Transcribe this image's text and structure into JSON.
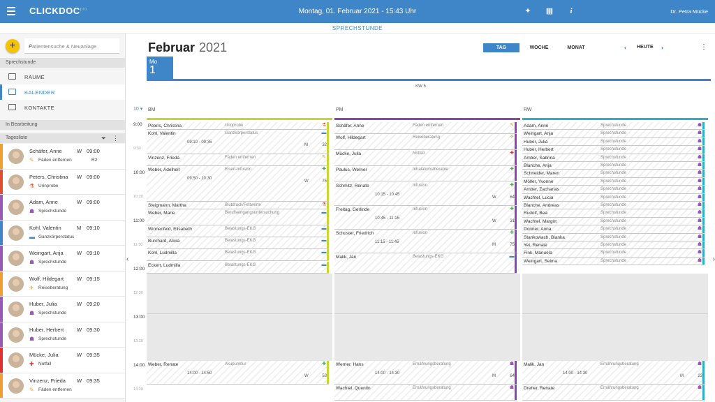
{
  "topbar": {
    "logo": "CLICKDOC",
    "logo_sup": "pro",
    "datetime": "Montag, 01. Februar 2021 - 15:43 Uhr",
    "user": "Dr. Petra Mücke",
    "icons": [
      "menu-icon",
      "magic-wand-icon",
      "calendar-icon",
      "info-icon"
    ]
  },
  "subbar": {
    "title": "SPRECHSTUNDE"
  },
  "sidebar": {
    "search_placeholder": "Patientensuche & Neuanlage",
    "section_sprechstunde": "Sprechstunde",
    "nav": [
      {
        "label": "RÄUME",
        "icon": "rooms-icon"
      },
      {
        "label": "KALENDER",
        "icon": "calendar-icon",
        "active": true
      },
      {
        "label": "KONTAKTE",
        "icon": "contacts-icon"
      }
    ],
    "section_bearbeitung": "In Bearbeitung",
    "tagesliste": "Tagesliste",
    "patients": [
      {
        "name": "Schäfer, Anne",
        "reason": "Fäden entfernen",
        "w": "W",
        "time": "09:00",
        "room": "R2",
        "color": "#f0a030",
        "icon": "✎"
      },
      {
        "name": "Peters, Christina",
        "reason": "Urinprobe",
        "w": "W",
        "time": "09:00",
        "room": "",
        "color": "#e05030",
        "icon": "⚗"
      },
      {
        "name": "Adam, Anne",
        "reason": "Sprechstunde",
        "w": "W",
        "time": "09:00",
        "room": "",
        "color": "#9b59b6",
        "icon": "☗"
      },
      {
        "name": "Kohl, Valentin",
        "reason": "Ganzkörperstatus",
        "w": "M",
        "time": "09:10",
        "room": "",
        "color": "#3f86c8",
        "icon": "▬"
      },
      {
        "name": "Weingart, Anja",
        "reason": "Sprechstunde",
        "w": "W",
        "time": "09:10",
        "room": "",
        "color": "#9b59b6",
        "icon": "☗"
      },
      {
        "name": "Wolf, Hildegart",
        "reason": "Reiseberatung",
        "w": "W",
        "time": "09:15",
        "room": "",
        "color": "#f0a030",
        "icon": "✈"
      },
      {
        "name": "Huber, Julia",
        "reason": "Sprechstunde",
        "w": "W",
        "time": "09:20",
        "room": "",
        "color": "#9b59b6",
        "icon": "☗"
      },
      {
        "name": "Huber, Herbert",
        "reason": "Sprechstunde",
        "w": "W",
        "time": "09:30",
        "room": "",
        "color": "#9b59b6",
        "icon": "☗"
      },
      {
        "name": "Mücke, Julia",
        "reason": "Notfall",
        "w": "W",
        "time": "09:35",
        "room": "",
        "color": "#e03030",
        "icon": "✚"
      },
      {
        "name": "Vinzenz, Frieda",
        "reason": "Fäden entfernen",
        "w": "W",
        "time": "09:35",
        "room": "",
        "color": "#f0a030",
        "icon": "✎"
      }
    ]
  },
  "calendar": {
    "month": "Februar",
    "year": "2021",
    "views": [
      "TAG",
      "WOCHE",
      "MONAT"
    ],
    "active_view": "TAG",
    "today_label": "HEUTE",
    "day_name": "Mo",
    "day_num": "1",
    "kw": "KW 5",
    "zoom": "10",
    "times": [
      "9:00",
      "9:30",
      "10:00",
      "10:30",
      "11:00",
      "11:30",
      "12:00",
      "12:30",
      "13:00",
      "13:30",
      "14:00",
      "14:30"
    ],
    "columns": [
      {
        "name": "BM",
        "color": "#c8d62e",
        "appointments": [
          {
            "name": "Peters, Christina",
            "reason": "Urinprobe",
            "slot": 0,
            "rows": 1,
            "icon": "⚗",
            "iconcolor": "#e05030"
          },
          {
            "name": "Kohl, Valentin",
            "reason": "Ganzkörperstatus",
            "time": "09:10 - 09:35",
            "gender": "M",
            "age": "32",
            "slot": 1,
            "rows": 3,
            "icon": "▬",
            "iconcolor": "#3f86c8"
          },
          {
            "name": "Vinzenz, Frieda",
            "reason": "Fäden entfernen",
            "slot": 4,
            "rows": 1.5,
            "icon": "✎",
            "iconcolor": "#f0a030"
          },
          {
            "name": "Weber, Adelheit",
            "reason": "Eisen-Infusion",
            "time": "09:50 - 10:30",
            "gender": "W",
            "age": "75",
            "slot": 5.5,
            "rows": 4.5,
            "icon": "✚",
            "iconcolor": "#4caf50"
          },
          {
            "name": "Steigmann, Martha",
            "reason": "Blutdruck/Fettwerte",
            "slot": 10,
            "rows": 1,
            "icon": "⚗",
            "iconcolor": "#e05030"
          },
          {
            "name": "Weber, Marie",
            "reason": "Berufseingangsuntersuchung",
            "slot": 11,
            "rows": 2,
            "icon": "▬",
            "iconcolor": "#3f86c8"
          },
          {
            "name": "Winnenfeld, Elisabeth",
            "reason": "Belastungs-EKG",
            "slot": 13,
            "rows": 1.5,
            "icon": "▬",
            "iconcolor": "#3f86c8"
          },
          {
            "name": "Burchard, Alicia",
            "reason": "Belastungs-EKG",
            "slot": 14.5,
            "rows": 1.5,
            "icon": "▬",
            "iconcolor": "#3f86c8"
          },
          {
            "name": "Kohl, Ludmilla",
            "reason": "Belastungs-EKG",
            "slot": 16,
            "rows": 1.5,
            "icon": "▬",
            "iconcolor": "#3f86c8"
          },
          {
            "name": "Eckert, Ludmilla",
            "reason": "Belastungs-EKG",
            "slot": 17.5,
            "rows": 1.5,
            "icon": "▬",
            "iconcolor": "#3f86c8"
          },
          {
            "name": "Weber, Renate",
            "reason": "Akupunktur",
            "time": "14:00 - 14:50",
            "gender": "W",
            "age": "53",
            "slot": 30,
            "rows": 3,
            "icon": "✚",
            "iconcolor": "#4caf50"
          }
        ]
      },
      {
        "name": "PM",
        "color": "#8e44ad",
        "appointments": [
          {
            "name": "Schäfer, Anne",
            "reason": "Fäden entfernen",
            "slot": 0,
            "rows": 1.5,
            "icon": "✎",
            "iconcolor": "#f0a030"
          },
          {
            "name": "Wolf, Hildegart",
            "reason": "Reiseberatung",
            "slot": 1.5,
            "rows": 2,
            "icon": "✈",
            "iconcolor": "#f0a030"
          },
          {
            "name": "Mücke, Julia",
            "reason": "Notfall",
            "slot": 3.5,
            "rows": 2,
            "icon": "✚",
            "iconcolor": "#e03030"
          },
          {
            "name": "Paulus, Werner",
            "reason": "Inhalationstherapie",
            "slot": 5.5,
            "rows": 2,
            "icon": "✚",
            "iconcolor": "#4caf50"
          },
          {
            "name": "Schmitz, Renate",
            "reason": "Infusion",
            "time": "10:15 - 10:45",
            "gender": "W",
            "age": "64",
            "slot": 7.5,
            "rows": 3,
            "icon": "✚",
            "iconcolor": "#4caf50"
          },
          {
            "name": "Freitag, Gerlinde",
            "reason": "Infusion",
            "time": "10:45 - 11:15",
            "gender": "W",
            "age": "31",
            "slot": 10.5,
            "rows": 3,
            "icon": "✚",
            "iconcolor": "#4caf50"
          },
          {
            "name": "Schuster, Friedrich",
            "reason": "Infusion",
            "time": "11:15 - 11:45",
            "gender": "M",
            "age": "75",
            "slot": 13.5,
            "rows": 3,
            "icon": "✚",
            "iconcolor": "#4caf50"
          },
          {
            "name": "Malik, Jan",
            "reason": "Belastungs-EKG",
            "slot": 16.5,
            "rows": 2.5,
            "icon": "▬",
            "iconcolor": "#3f86c8"
          },
          {
            "name": "Werner, Hans",
            "reason": "Ernährungsberatung",
            "time": "14:00 - 14:30",
            "gender": "M",
            "age": "64",
            "slot": 30,
            "rows": 3,
            "icon": "☗",
            "iconcolor": "#9b59b6"
          },
          {
            "name": "Wachtel, Quentin",
            "reason": "Ernährungsberatung",
            "slot": 33,
            "rows": 2,
            "icon": "☗",
            "iconcolor": "#9b59b6"
          }
        ]
      },
      {
        "name": "RW",
        "color": "#2ab3c8",
        "appointments": [
          {
            "name": "Adam, Anne",
            "reason": "Sprechstunde",
            "slot": 0,
            "rows": 1,
            "icon": "☗",
            "iconcolor": "#9b59b6"
          },
          {
            "name": "Weingart, Anja",
            "reason": "Sprechstunde",
            "slot": 1,
            "rows": 1,
            "icon": "☗",
            "iconcolor": "#9b59b6"
          },
          {
            "name": "Huber, Julia",
            "reason": "Sprechstunde",
            "slot": 2,
            "rows": 1,
            "icon": "☗",
            "iconcolor": "#9b59b6"
          },
          {
            "name": "Huber, Herbert",
            "reason": "Sprechstunde",
            "slot": 3,
            "rows": 1,
            "icon": "☗",
            "iconcolor": "#9b59b6"
          },
          {
            "name": "Amber, Sabrina",
            "reason": "Sprechstunde",
            "slot": 4,
            "rows": 1,
            "icon": "☗",
            "iconcolor": "#9b59b6"
          },
          {
            "name": "Blanche, Anja",
            "reason": "Sprechstunde",
            "slot": 5,
            "rows": 1,
            "icon": "☗",
            "iconcolor": "#9b59b6"
          },
          {
            "name": "Schneider, Maren",
            "reason": "Sprechstunde",
            "slot": 6,
            "rows": 1,
            "icon": "☗",
            "iconcolor": "#9b59b6"
          },
          {
            "name": "Möller, Yvonne",
            "reason": "Sprechstunde",
            "slot": 7,
            "rows": 1,
            "icon": "☗",
            "iconcolor": "#9b59b6"
          },
          {
            "name": "Amber, Zacharias",
            "reason": "Sprechstunde",
            "slot": 8,
            "rows": 1,
            "icon": "☗",
            "iconcolor": "#9b59b6"
          },
          {
            "name": "Wachtel, Lucia",
            "reason": "Sprechstunde",
            "slot": 9,
            "rows": 1,
            "icon": "☗",
            "iconcolor": "#9b59b6"
          },
          {
            "name": "Blanche, Andreas",
            "reason": "Sprechstunde",
            "slot": 10,
            "rows": 1,
            "icon": "☗",
            "iconcolor": "#9b59b6"
          },
          {
            "name": "Rudolf, Bea",
            "reason": "Sprechstunde",
            "slot": 11,
            "rows": 1,
            "icon": "☗",
            "iconcolor": "#9b59b6"
          },
          {
            "name": "Wachtel, Margot",
            "reason": "Sprechstunde",
            "slot": 12,
            "rows": 1,
            "icon": "☗",
            "iconcolor": "#9b59b6"
          },
          {
            "name": "Donner, Anna",
            "reason": "Sprechstunde",
            "slot": 13,
            "rows": 1,
            "icon": "☗",
            "iconcolor": "#9b59b6"
          },
          {
            "name": "Stankowach, Bianka",
            "reason": "Sprechstunde",
            "slot": 14,
            "rows": 1,
            "icon": "☗",
            "iconcolor": "#9b59b6"
          },
          {
            "name": "Yet, Renate",
            "reason": "Sprechstunde",
            "slot": 15,
            "rows": 1,
            "icon": "☗",
            "iconcolor": "#9b59b6"
          },
          {
            "name": "Fink, Manuela",
            "reason": "Sprechstunde",
            "slot": 16,
            "rows": 1,
            "icon": "☗",
            "iconcolor": "#9b59b6"
          },
          {
            "name": "Weingart, Selma",
            "reason": "Sprechstunde",
            "slot": 17,
            "rows": 1,
            "icon": "☗",
            "iconcolor": "#9b59b6"
          },
          {
            "name": "Malik, Jan",
            "reason": "Ernährungsberatung",
            "time": "14:00 - 14:30",
            "gender": "M",
            "age": "23",
            "slot": 30,
            "rows": 3,
            "icon": "☗",
            "iconcolor": "#9b59b6"
          },
          {
            "name": "Dreher, Renate",
            "reason": "Ernährungsberatung",
            "slot": 33,
            "rows": 2,
            "icon": "☗",
            "iconcolor": "#9b59b6"
          }
        ]
      }
    ]
  }
}
